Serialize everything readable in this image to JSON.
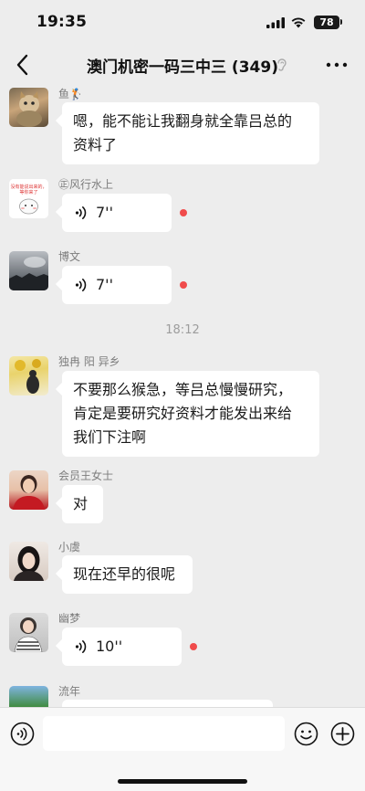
{
  "status_bar": {
    "time": "19:35",
    "battery": "78"
  },
  "header": {
    "title": "澳门机密一码三中三 (349)"
  },
  "messages": [
    {
      "sender": "鱼🏌",
      "type": "text",
      "lines": [
        "嗯，能不能让我翻身就全靠吕总的",
        "资料了"
      ]
    },
    {
      "sender": "㊣风行水上",
      "type": "voice",
      "duration": "7''",
      "avatar_text": "没有能说出来的，\n等你来了"
    },
    {
      "sender": "博文",
      "type": "voice",
      "duration": "7''"
    },
    {
      "divider": "18:12"
    },
    {
      "sender": "独冉 阳 异乡",
      "type": "text",
      "lines": [
        "不要那么猴急，等吕总慢慢研究，",
        "肯定是要研究好资料才能发出来给",
        "我们下注啊"
      ]
    },
    {
      "sender": "会员王女士",
      "type": "text",
      "lines": [
        "对"
      ]
    },
    {
      "sender": "小虞",
      "type": "text",
      "lines": [
        "现在还早的很呢"
      ]
    },
    {
      "sender": "幽梦",
      "type": "voice",
      "duration": "10''"
    },
    {
      "sender": "流年",
      "type": "text",
      "lines": [
        ""
      ]
    }
  ],
  "input": {
    "placeholder": ""
  }
}
